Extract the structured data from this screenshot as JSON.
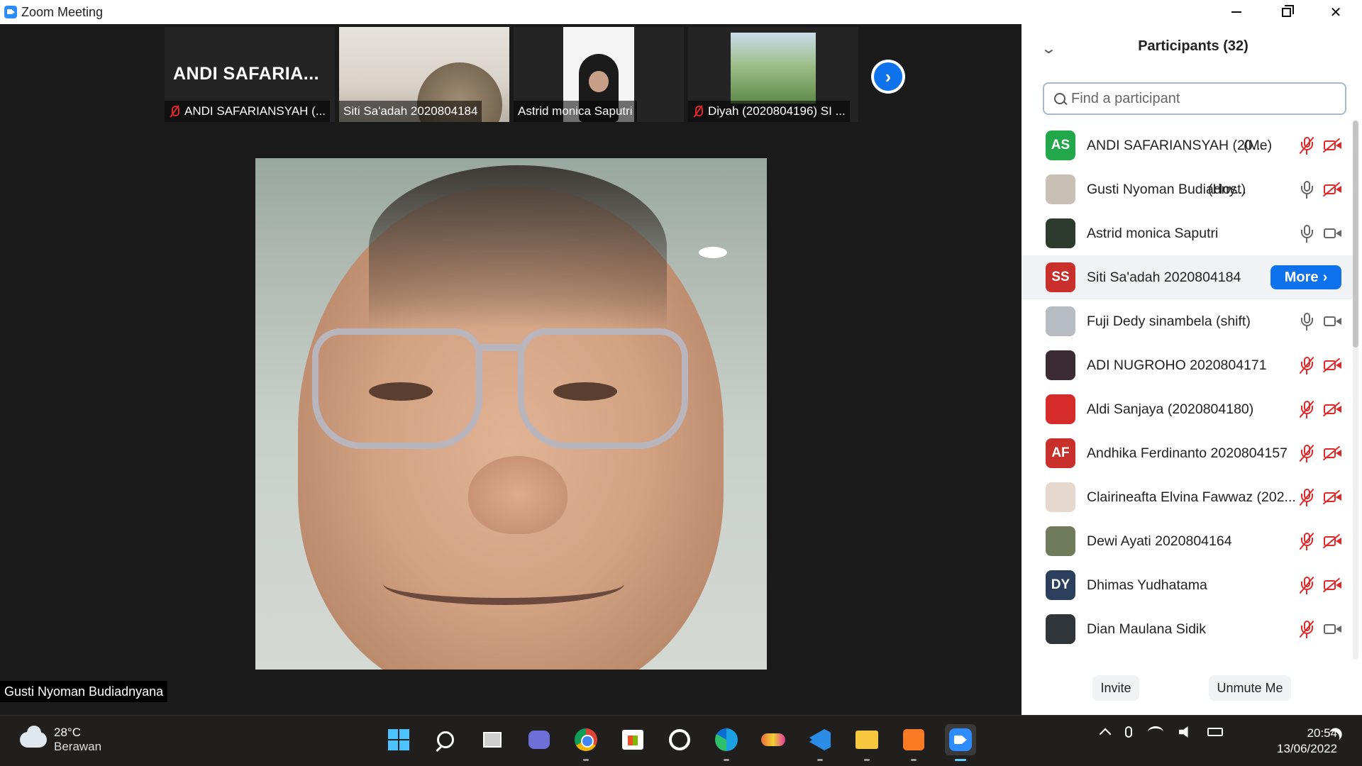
{
  "window": {
    "title": "Zoom Meeting"
  },
  "gallery": {
    "thumbs": [
      {
        "name": "ANDI SAFARIANSYAH (...",
        "display_name": "ANDI  SAFARIA...",
        "muted": true
      },
      {
        "name": "Siti Sa'adah 2020804184",
        "muted": false
      },
      {
        "name": "Astrid monica Saputri",
        "muted": false
      },
      {
        "name": "Diyah (2020804196) SI ...",
        "muted": true
      }
    ]
  },
  "active_speaker": {
    "name": "Gusti Nyoman Budiadnyana"
  },
  "participants_panel": {
    "title": "Participants (32)",
    "search_placeholder": "Find a participant",
    "more_label": "More",
    "participants": [
      {
        "name": "ANDI SAFARIANSYAH (20...",
        "role": "(Me)",
        "initials": "AS",
        "avatar_color": "#22a74a",
        "mic": "off",
        "cam": "off"
      },
      {
        "name": "Gusti Nyoman Budiadny...",
        "role": "(Host)",
        "initials": "",
        "avatar_color": "#c9c0b5",
        "mic": "on",
        "cam": "off"
      },
      {
        "name": "Astrid monica Saputri",
        "role": "",
        "initials": "",
        "avatar_color": "#2d3a2e",
        "mic": "on",
        "cam": "on"
      },
      {
        "name": "Siti Sa'adah 2020804184",
        "role": "",
        "initials": "SS",
        "avatar_color": "#c9302c",
        "mic": "more",
        "cam": "more"
      },
      {
        "name": "Fuji Dedy sinambela (shift)",
        "role": "",
        "initials": "",
        "avatar_color": "#b7bcc2",
        "mic": "on",
        "cam": "on"
      },
      {
        "name": "ADI NUGROHO 2020804171",
        "role": "",
        "initials": "",
        "avatar_color": "#3b2b33",
        "mic": "off",
        "cam": "off"
      },
      {
        "name": "Aldi Sanjaya (2020804180)",
        "role": "",
        "initials": "",
        "avatar_color": "#d62b2b",
        "mic": "off",
        "cam": "off"
      },
      {
        "name": "Andhika Ferdinanto 2020804157",
        "role": "",
        "initials": "AF",
        "avatar_color": "#c9302c",
        "mic": "off",
        "cam": "off"
      },
      {
        "name": "Clairineafta Elvina Fawwaz (202...",
        "role": "",
        "initials": "",
        "avatar_color": "#e7d8cf",
        "mic": "off",
        "cam": "off"
      },
      {
        "name": "Dewi Ayati 2020804164",
        "role": "",
        "initials": "",
        "avatar_color": "#6f7b5a",
        "mic": "off",
        "cam": "off"
      },
      {
        "name": "Dhimas Yudhatama",
        "role": "",
        "initials": "DY",
        "avatar_color": "#2b3f5c",
        "mic": "off",
        "cam": "off"
      },
      {
        "name": "Dian Maulana Sidik",
        "role": "",
        "initials": "",
        "avatar_color": "#30353a",
        "mic": "off",
        "cam": "on"
      }
    ],
    "invite_label": "Invite",
    "unmute_label": "Unmute Me"
  },
  "taskbar": {
    "weather": {
      "temp": "28°C",
      "condition": "Berawan"
    },
    "apps": [
      "start-icon",
      "search-icon",
      "task-view-icon",
      "chat-icon",
      "chrome-icon",
      "store-icon",
      "app-icon",
      "edge-icon",
      "app-icon",
      "vscode-icon",
      "file-explorer-icon",
      "xampp-icon",
      "zoom-icon"
    ],
    "clock": {
      "time": "20:54",
      "date": "13/06/2022"
    }
  }
}
